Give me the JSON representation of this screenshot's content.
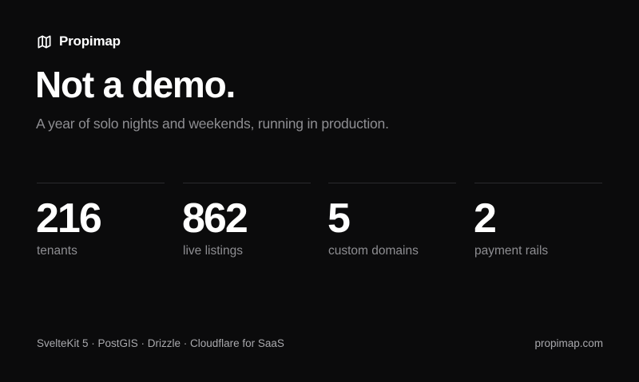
{
  "brand": {
    "name": "Propimap",
    "icon": "map-icon"
  },
  "hero": {
    "headline": "Not a demo.",
    "subtitle": "A year of solo nights and weekends, running in production."
  },
  "stats": [
    {
      "value": "216",
      "label": "tenants"
    },
    {
      "value": "862",
      "label": "live listings"
    },
    {
      "value": "5",
      "label": "custom domains"
    },
    {
      "value": "2",
      "label": "payment rails"
    }
  ],
  "footer": {
    "stack": "SvelteKit 5 · PostGIS · Drizzle · Cloudflare for SaaS",
    "domain": "propimap.com"
  },
  "colors": {
    "background": "#0b0b0c",
    "text": "#ffffff",
    "muted": "#8e8e92",
    "divider": "#2a2a2d"
  }
}
